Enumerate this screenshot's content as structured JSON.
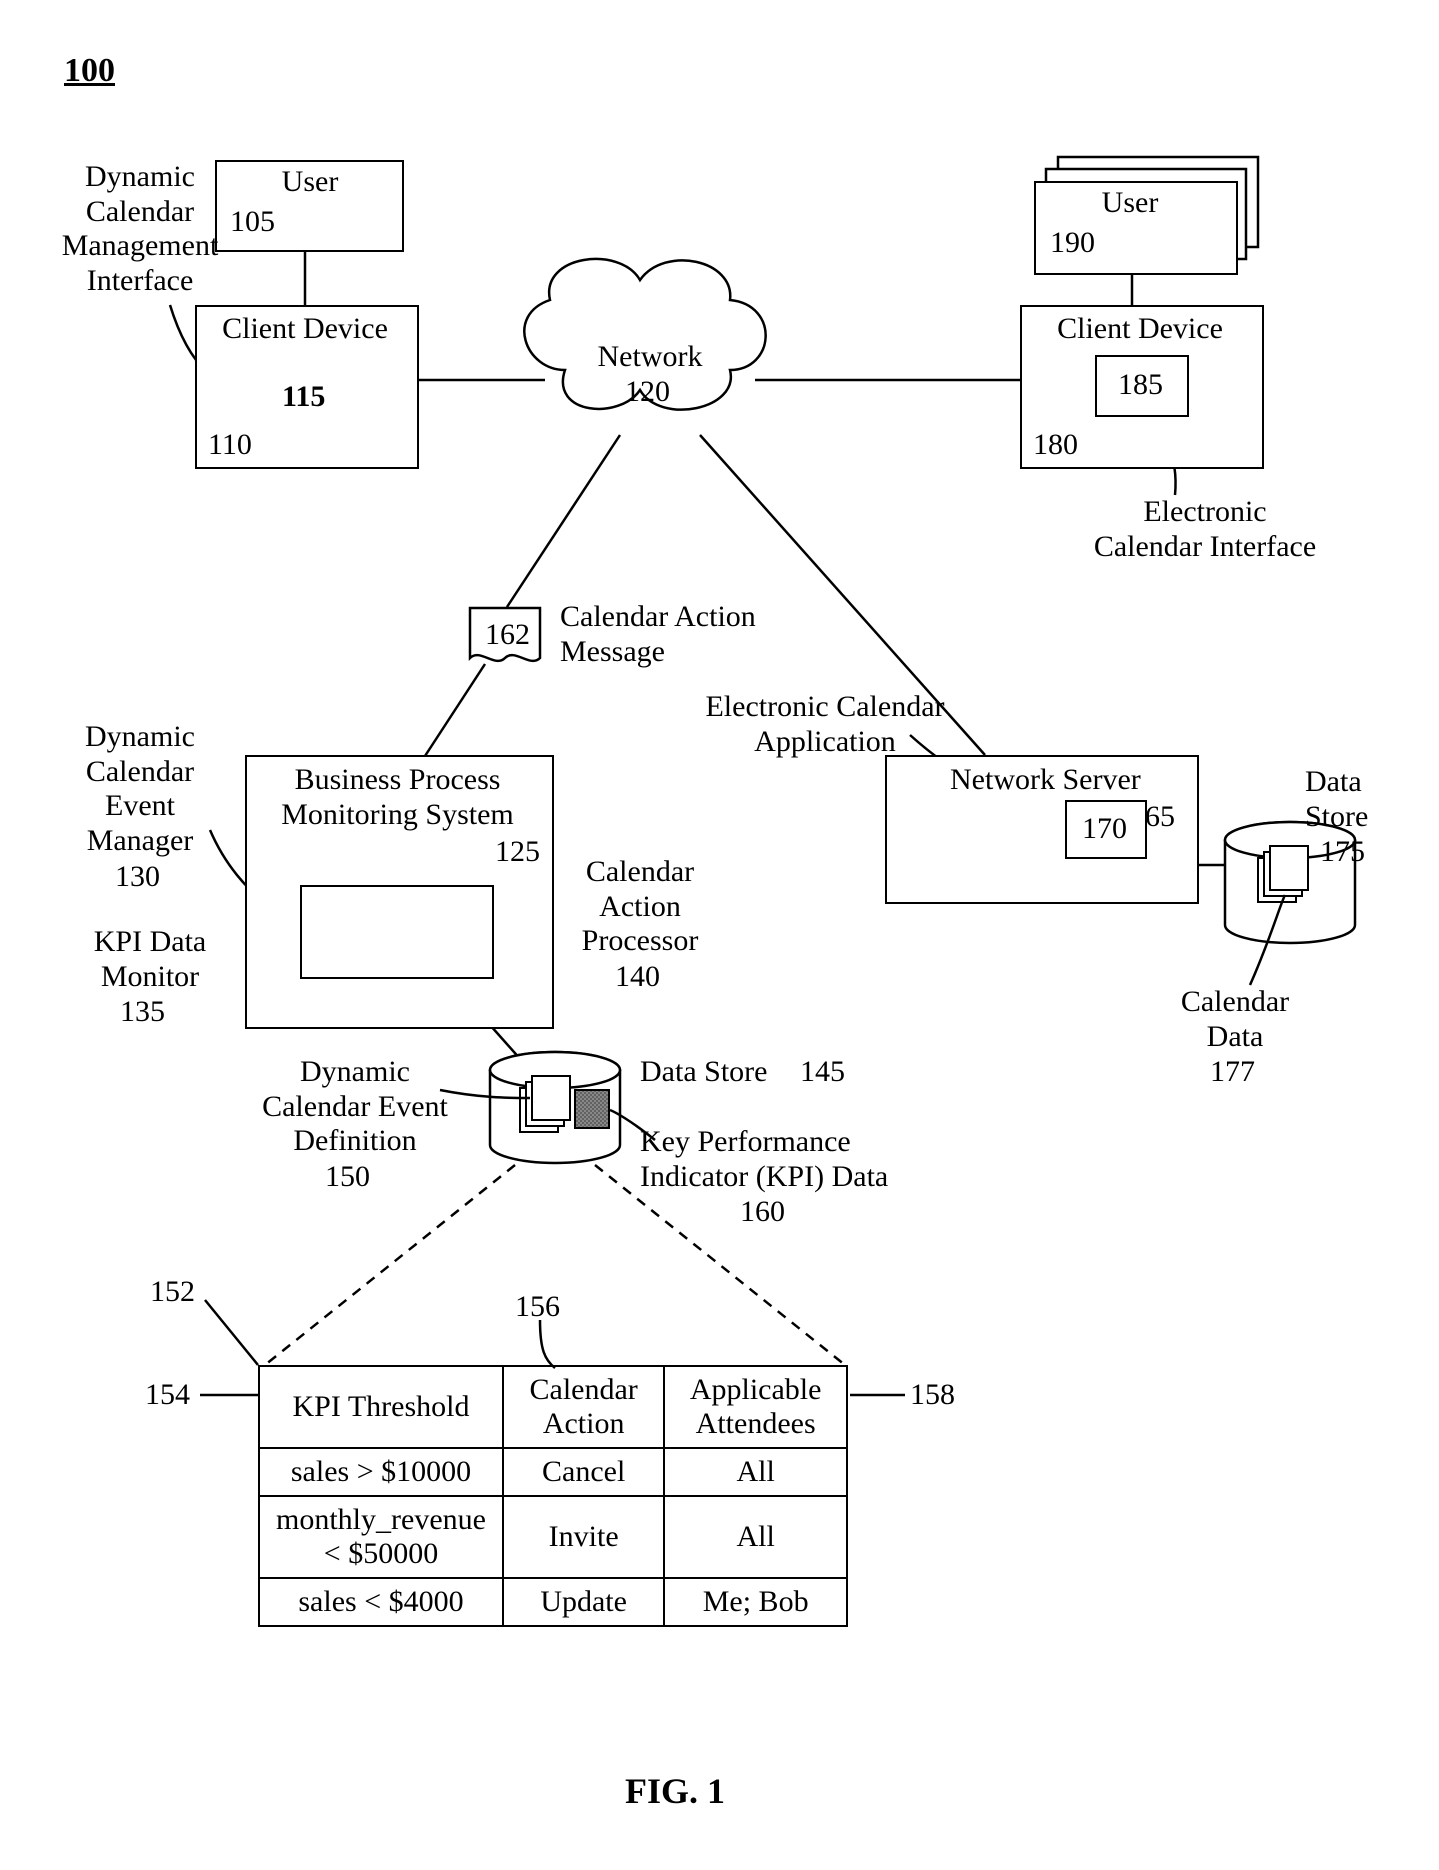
{
  "figure_ref": "100",
  "figure_caption": "FIG. 1",
  "labels": {
    "user_left": "User",
    "user_right": "User",
    "client_left": "Client Device",
    "client_right": "Client Device",
    "network": "Network",
    "dcmi": "Dynamic\nCalendar\nManagement\nInterface",
    "eci": "Electronic\nCalendar Interface",
    "cam": "Calendar Action\nMessage",
    "bpms": "Business Process\nMonitoring System",
    "dcem": "Dynamic\nCalendar\nEvent\nManager",
    "kpi_mon": "KPI Data\nMonitor",
    "cap": "Calendar\nAction\nProcessor",
    "eca": "Electronic Calendar\nApplication",
    "net_server": "Network Server",
    "ds_right": "Data\nStore",
    "cal_data": "Calendar\nData",
    "ds_left": "Data Store",
    "dced": "Dynamic\nCalendar Event\nDefinition",
    "kpi_data": "Key Performance\nIndicator (KPI) Data"
  },
  "refs": {
    "user_left": "105",
    "client_left": "110",
    "dcmi": "115",
    "network": "120",
    "bpms": "125",
    "dcem": "130",
    "kpi_mon": "135",
    "cap": "140",
    "ds_left": "145",
    "dced": "150",
    "table_ptr": "152",
    "col1_ptr": "154",
    "col2_ptr": "156",
    "col3_ptr": "158",
    "kpi_data": "160",
    "cam": "162",
    "net_server": "165",
    "eca": "170",
    "ds_right": "175",
    "cal_data": "177",
    "client_right": "180",
    "eci": "185",
    "user_right": "190"
  },
  "table": {
    "headers": [
      "KPI Threshold",
      "Calendar\nAction",
      "Applicable\nAttendees"
    ],
    "rows": [
      [
        "sales > $10000",
        "Cancel",
        "All"
      ],
      [
        "monthly_revenue\n< $50000",
        "Invite",
        "All"
      ],
      [
        "sales < $4000",
        "Update",
        "Me; Bob"
      ]
    ]
  }
}
